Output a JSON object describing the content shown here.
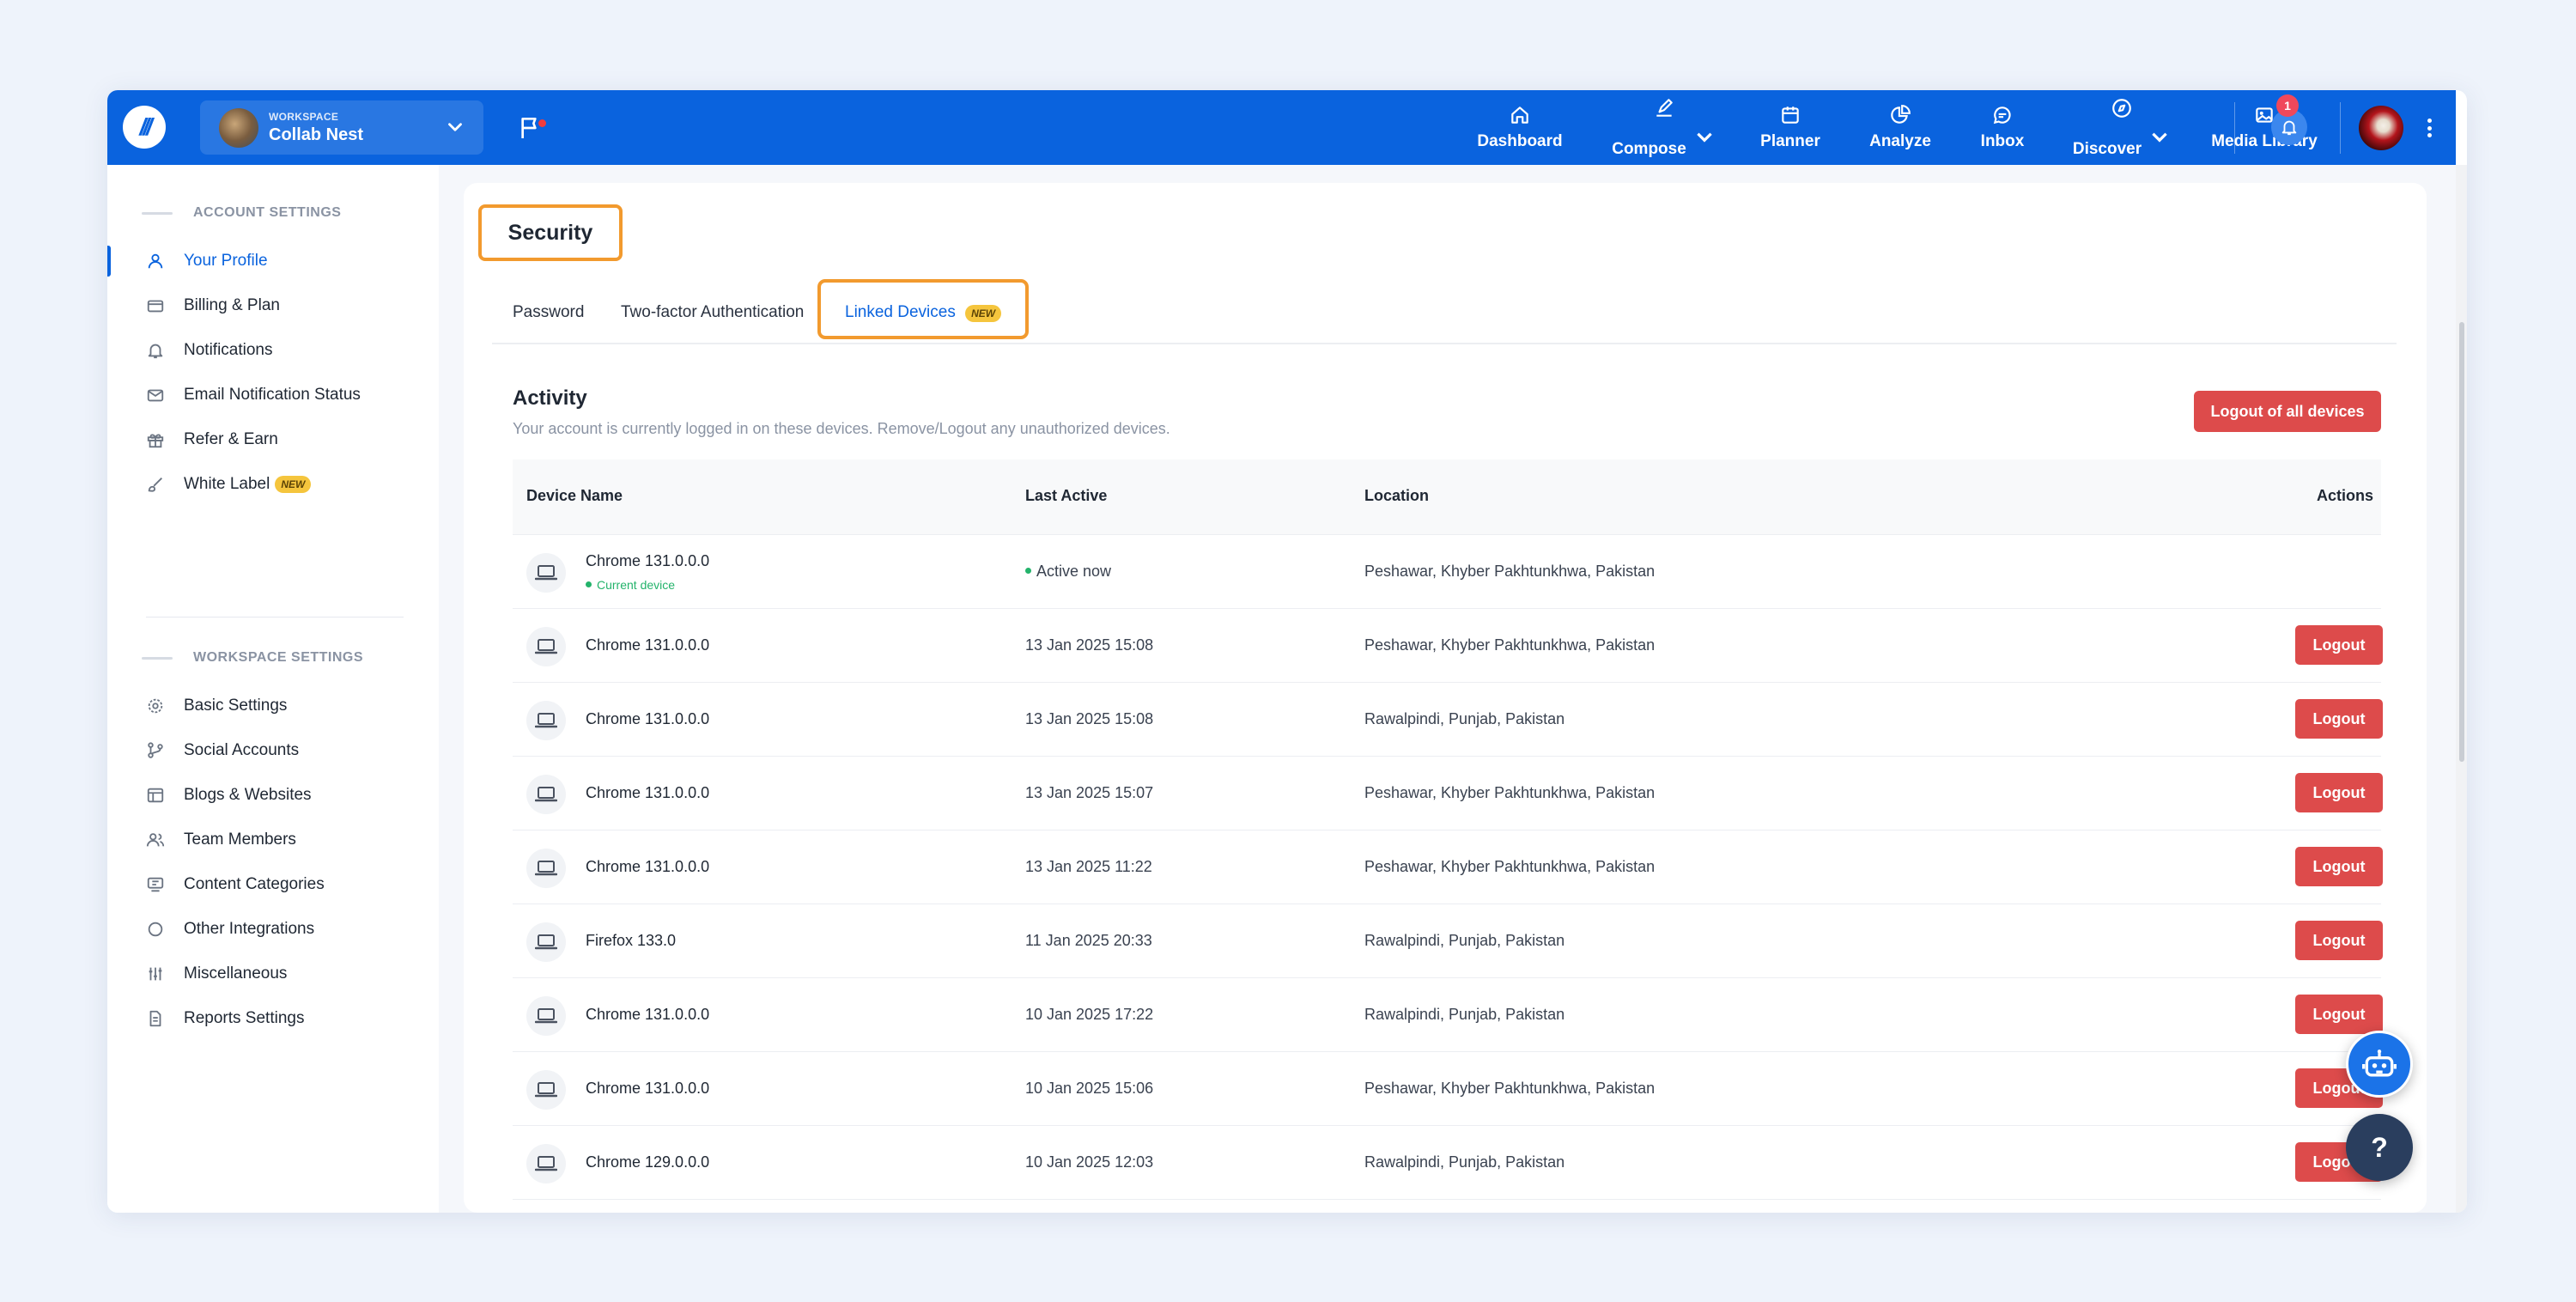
{
  "topbar": {
    "workspace_label": "WORKSPACE",
    "workspace_name": "Collab Nest",
    "notification_count": "1",
    "nav": [
      {
        "label": "Dashboard",
        "icon": "home-icon"
      },
      {
        "label": "Compose",
        "icon": "pen-icon",
        "has_dropdown": true
      },
      {
        "label": "Planner",
        "icon": "calendar-icon"
      },
      {
        "label": "Analyze",
        "icon": "pie-chart-icon"
      },
      {
        "label": "Inbox",
        "icon": "chat-icon"
      },
      {
        "label": "Discover",
        "icon": "compass-icon",
        "has_dropdown": true
      },
      {
        "label": "Media Library",
        "icon": "image-icon"
      }
    ]
  },
  "sidebar": {
    "account_title": "ACCOUNT SETTINGS",
    "account_items": [
      {
        "label": "Your Profile",
        "icon": "user-icon",
        "active": true
      },
      {
        "label": "Billing & Plan",
        "icon": "credit-card-icon"
      },
      {
        "label": "Notifications",
        "icon": "bell-icon"
      },
      {
        "label": "Email Notification Status",
        "icon": "mail-icon"
      },
      {
        "label": "Refer & Earn",
        "icon": "gift-icon"
      },
      {
        "label": "White Label",
        "icon": "brush-icon",
        "badge": "NEW"
      }
    ],
    "workspace_title": "WORKSPACE SETTINGS",
    "workspace_items": [
      {
        "label": "Basic Settings",
        "icon": "gear-icon"
      },
      {
        "label": "Social Accounts",
        "icon": "branch-icon"
      },
      {
        "label": "Blogs & Websites",
        "icon": "layout-icon"
      },
      {
        "label": "Team Members",
        "icon": "team-icon"
      },
      {
        "label": "Content Categories",
        "icon": "category-icon"
      },
      {
        "label": "Other Integrations",
        "icon": "circle-icon"
      },
      {
        "label": "Miscellaneous",
        "icon": "sliders-icon"
      },
      {
        "label": "Reports Settings",
        "icon": "document-icon"
      }
    ]
  },
  "main": {
    "section_title": "Security",
    "tabs": [
      {
        "label": "Password"
      },
      {
        "label": "Two-factor Authentication"
      },
      {
        "label": "Linked Devices",
        "badge": "NEW",
        "active": true
      }
    ],
    "activity_title": "Activity",
    "activity_desc": "Your account is currently logged in on these devices. Remove/Logout any unauthorized devices.",
    "logout_all_label": "Logout of all devices",
    "columns": [
      "Device Name",
      "Last Active",
      "Location",
      "Actions"
    ],
    "logout_label": "Logout",
    "current_device_label": "Current device",
    "rows": [
      {
        "device": "Chrome 131.0.0.0",
        "last_active": "Active now",
        "location": "Peshawar, Khyber Pakhtunkhwa, Pakistan",
        "current": true
      },
      {
        "device": "Chrome 131.0.0.0",
        "last_active": "13 Jan 2025 15:08",
        "location": "Peshawar, Khyber Pakhtunkhwa, Pakistan"
      },
      {
        "device": "Chrome 131.0.0.0",
        "last_active": "13 Jan 2025 15:08",
        "location": "Rawalpindi, Punjab, Pakistan"
      },
      {
        "device": "Chrome 131.0.0.0",
        "last_active": "13 Jan 2025 15:07",
        "location": "Peshawar, Khyber Pakhtunkhwa, Pakistan"
      },
      {
        "device": "Chrome 131.0.0.0",
        "last_active": "13 Jan 2025 11:22",
        "location": "Peshawar, Khyber Pakhtunkhwa, Pakistan"
      },
      {
        "device": "Firefox 133.0",
        "last_active": "11 Jan 2025 20:33",
        "location": "Rawalpindi, Punjab, Pakistan"
      },
      {
        "device": "Chrome 131.0.0.0",
        "last_active": "10 Jan 2025 17:22",
        "location": "Rawalpindi, Punjab, Pakistan"
      },
      {
        "device": "Chrome 131.0.0.0",
        "last_active": "10 Jan 2025 15:06",
        "location": "Peshawar, Khyber Pakhtunkhwa, Pakistan"
      },
      {
        "device": "Chrome 129.0.0.0",
        "last_active": "10 Jan 2025 12:03",
        "location": "Rawalpindi, Punjab, Pakistan"
      }
    ]
  },
  "fab": {
    "help_label": "?"
  },
  "colors": {
    "brand": "#0a63de",
    "danger": "#dd4b4b",
    "highlight": "#f29a2e",
    "success": "#24b36b"
  }
}
